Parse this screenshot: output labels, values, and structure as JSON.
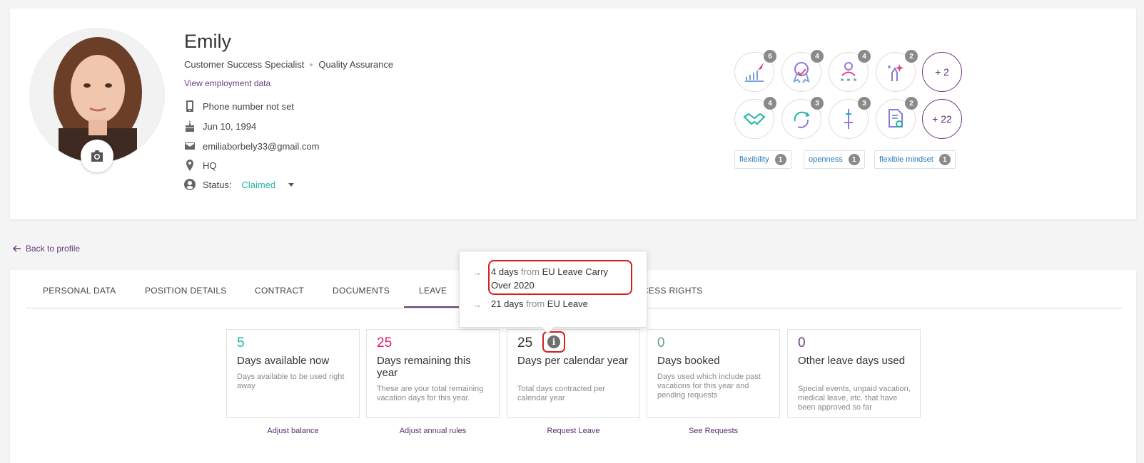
{
  "profile": {
    "name": "Emily",
    "position": "Customer Success Specialist",
    "department": "Quality Assurance",
    "employment_link": "View employment data",
    "phone": "Phone number not set",
    "birthday": "Jun 10, 1994",
    "email": "emiliaborbely33@gmail.com",
    "location": "HQ",
    "status_label": "Status:",
    "status_value": "Claimed"
  },
  "badges": [
    {
      "icon": "rocket-chart-icon",
      "count": "6"
    },
    {
      "icon": "award-ribbon-icon",
      "count": "4"
    },
    {
      "icon": "person-stars-icon",
      "count": "4"
    },
    {
      "icon": "hand-sparkle-icon",
      "count": "2"
    },
    {
      "icon": "handshake-icon",
      "count": "4"
    },
    {
      "icon": "cycle-arrows-icon",
      "count": "3"
    },
    {
      "icon": "sword-icon",
      "count": "3"
    },
    {
      "icon": "document-search-icon",
      "count": "2"
    }
  ],
  "badge_more": [
    "+ 2",
    "+ 22"
  ],
  "tags": [
    {
      "label": "flexibility",
      "count": "1"
    },
    {
      "label": "openness",
      "count": "1"
    },
    {
      "label": "flexible mindset",
      "count": "1"
    }
  ],
  "back_link": "Back to profile",
  "tabs": [
    "PERSONAL DATA",
    "POSITION DETAILS",
    "CONTRACT",
    "DOCUMENTS",
    "LEAVE",
    "CCESS RIGHTS"
  ],
  "tooltip": {
    "row1_amount": "4 days",
    "row1_from": "from",
    "row1_source": "EU Leave Carry Over 2020",
    "row2_amount": "21 days",
    "row2_from": "from",
    "row2_source": "EU Leave"
  },
  "stats": [
    {
      "value": "5",
      "title": "Days available now",
      "desc": "Days available to be used right away",
      "link": "Adjust balance"
    },
    {
      "value": "25",
      "title": "Days remaining this year",
      "desc": "These are your total remaining vacation days for this year.",
      "link": "Adjust annual rules"
    },
    {
      "value": "25",
      "title": "Days per calendar year",
      "desc": "Total days contracted per calendar year",
      "link": "Request Leave"
    },
    {
      "value": "0",
      "title": "Days booked",
      "desc": "Days used which include past vacations for this year and pending requests",
      "link": "See Requests"
    },
    {
      "value": "0",
      "title": "Other leave days used",
      "desc": "Special events, unpaid vacation, medical leave, etc. that have been approved so far",
      "link": ""
    }
  ],
  "colors": {
    "accent": "#6a3c7c",
    "teal": "#1db7a3",
    "pink": "#e0186c",
    "highlight": "#d62020"
  }
}
